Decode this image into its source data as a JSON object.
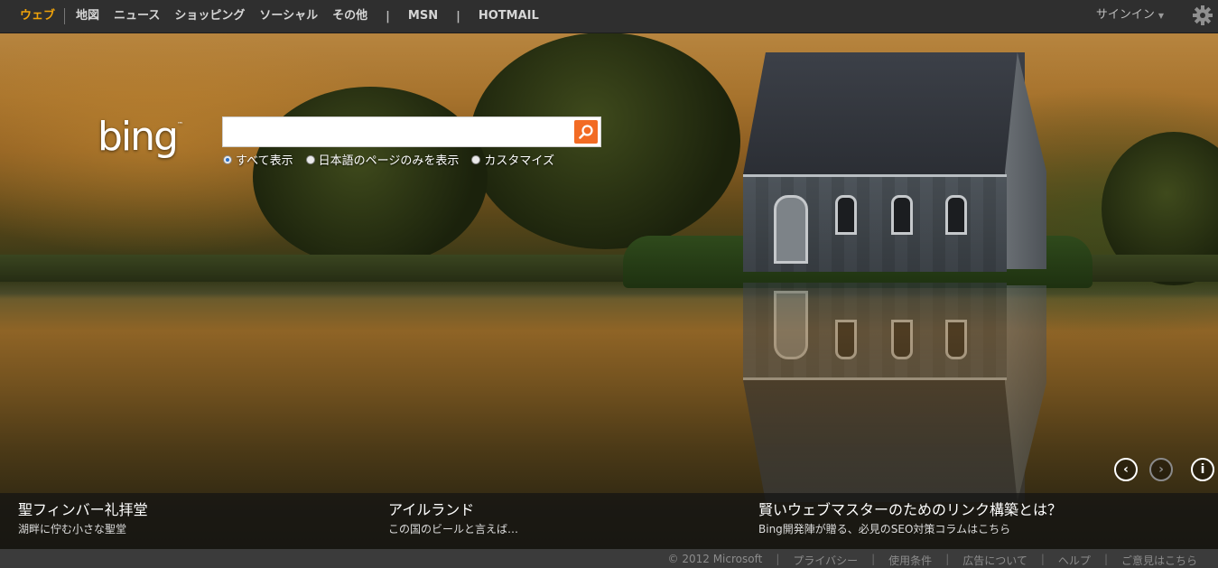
{
  "nav": {
    "items": [
      "ウェブ",
      "地図",
      "ニュース",
      "ショッピング",
      "ソーシャル",
      "その他"
    ],
    "separator": "|",
    "extras": [
      "MSN",
      "HOTMAIL"
    ],
    "signin": "サインイン"
  },
  "logo": {
    "text": "bing",
    "tm": "™"
  },
  "search": {
    "value": "",
    "scopes": [
      "すべて表示",
      "日本語のページのみを表示",
      "カスタマイズ"
    ],
    "selected_scope": 0
  },
  "captions": [
    {
      "title": "聖フィンバー礼拝堂",
      "subtitle": "湖畔に佇む小さな聖堂"
    },
    {
      "title": "アイルランド",
      "subtitle": "この国のビールと言えば…"
    },
    {
      "title": "賢いウェブマスターのためのリンク構築とは？",
      "subtitle": "Bing開発陣が贈る、必見のSEO対策コラムはこちら"
    }
  ],
  "footer": {
    "links": [
      "© 2012 Microsoft",
      "プライバシー",
      "使用条件",
      "広告について",
      "ヘルプ",
      "ご意見はこちら"
    ],
    "separator": "|"
  },
  "colors": {
    "active_nav": "#f0a30a",
    "search_button": "#f26b24",
    "radio_selected": "#2a6fc9"
  }
}
